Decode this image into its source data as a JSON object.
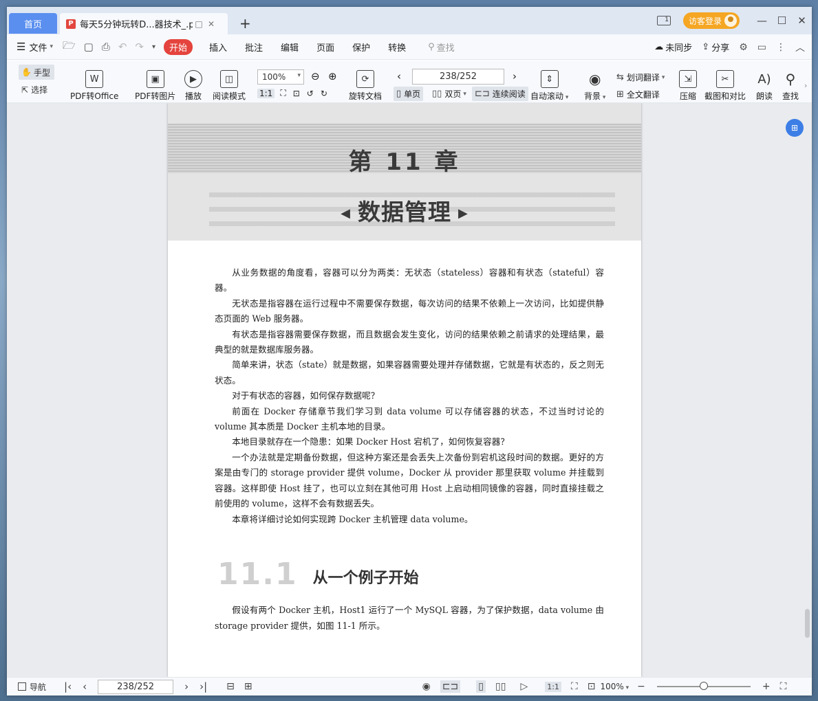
{
  "titlebar": {
    "home_tab": "首页",
    "doc_tab": "每天5分钟玩转D...器技术_.pdf",
    "login": "访客登录",
    "page_badge": "1"
  },
  "menubar": {
    "file": "文件",
    "tabs": [
      "开始",
      "插入",
      "批注",
      "编辑",
      "页面",
      "保护",
      "转换"
    ],
    "search_placeholder": "查找",
    "sync": "未同步",
    "share": "分享"
  },
  "toolbar": {
    "hand": "手型",
    "select": "选择",
    "pdf_to_office": "PDF转Office",
    "pdf_to_image": "PDF转图片",
    "play": "播放",
    "reading_mode": "阅读模式",
    "zoom": "100%",
    "rotate": "旋转文档",
    "page_indicator": "238/252",
    "single_page": "单页",
    "double_page": "双页",
    "continuous": "连续阅读",
    "auto_scroll": "自动滚动",
    "background": "背景",
    "word_translate": "划词翻译",
    "full_translate": "全文翻译",
    "compress": "压缩",
    "screenshot_compare": "截图和对比",
    "read_aloud": "朗读",
    "find": "查找"
  },
  "document": {
    "chapter": "第 11 章",
    "chapter_name": "数据管理",
    "paragraphs": [
      "从业务数据的角度看，容器可以分为两类：无状态（stateless）容器和有状态（stateful）容器。",
      "无状态是指容器在运行过程中不需要保存数据，每次访问的结果不依赖上一次访问，比如提供静态页面的 Web 服务器。",
      "有状态是指容器需要保存数据，而且数据会发生变化，访问的结果依赖之前请求的处理结果，最典型的就是数据库服务器。",
      "简单来讲，状态（state）就是数据，如果容器需要处理并存储数据，它就是有状态的，反之则无状态。",
      "对于有状态的容器，如何保存数据呢？",
      "前面在 Docker 存储章节我们学习到 data volume 可以存储容器的状态，不过当时讨论的 volume 其本质是 Docker 主机本地的目录。",
      "本地目录就存在一个隐患：如果 Docker Host 宕机了，如何恢复容器？",
      "一个办法就是定期备份数据，但这种方案还是会丢失上次备份到宕机这段时间的数据。更好的方案是由专门的 storage provider 提供 volume，Docker 从 provider 那里获取 volume 并挂载到容器。这样即使 Host 挂了，也可以立刻在其他可用 Host 上启动相同镜像的容器，同时直接挂载之前使用的 volume，这样不会有数据丢失。",
      "本章将详细讨论如何实现跨 Docker 主机管理 data volume。"
    ],
    "section_number": "11.1",
    "section_title": "从一个例子开始",
    "section_paragraph": "假设有两个 Docker 主机，Host1 运行了一个 MySQL 容器，为了保护数据，data volume 由 storage provider 提供，如图 11-1 所示。"
  },
  "statusbar": {
    "nav": "导航",
    "page": "238/252",
    "zoom": "100%"
  },
  "colors": {
    "accent": "#e4443d",
    "home_tab": "#5a8ff0",
    "login": "#f5a623"
  }
}
